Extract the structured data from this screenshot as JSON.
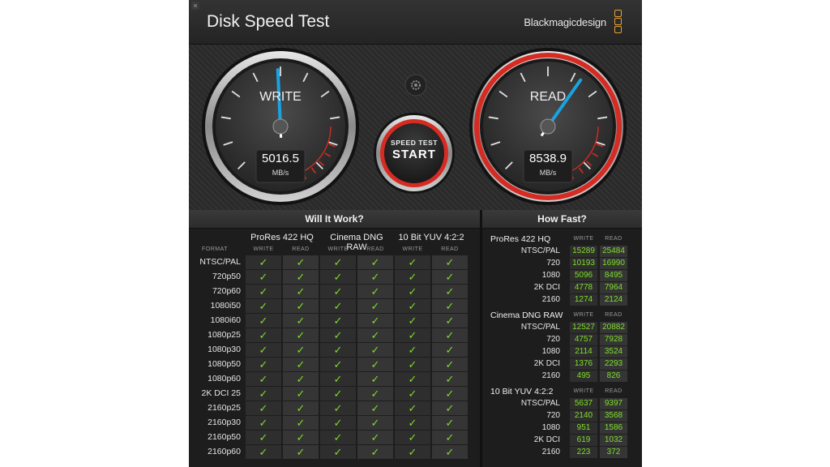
{
  "app": {
    "title": "Disk Speed Test",
    "brand": "Blackmagicdesign",
    "close_icon": "×"
  },
  "gauges": {
    "write": {
      "label": "WRITE",
      "value": "5016.5",
      "unit": "MB/s",
      "needle_fraction": 0.49
    },
    "read": {
      "label": "READ",
      "value": "8538.9",
      "unit": "MB/s",
      "needle_fraction": 0.63
    }
  },
  "start_button": {
    "top": "SPEED TEST",
    "main": "START"
  },
  "settings_icon": "gear-icon",
  "colors": {
    "accent": "#1aa3e0",
    "red": "#d52b22",
    "green": "#7fde2a",
    "orange": "#e8a035"
  },
  "will_it_work": {
    "title": "Will It Work?",
    "format_label": "FORMAT",
    "groups": [
      "ProRes 422 HQ",
      "Cinema DNG RAW",
      "10 Bit YUV 4:2:2"
    ],
    "sub_write": "WRITE",
    "sub_read": "READ",
    "check": "✓",
    "rows": [
      "NTSC/PAL",
      "720p50",
      "720p60",
      "1080i50",
      "1080i60",
      "1080p25",
      "1080p30",
      "1080p50",
      "1080p60",
      "2K DCI 25",
      "2160p25",
      "2160p30",
      "2160p50",
      "2160p60"
    ]
  },
  "how_fast": {
    "title": "How Fast?",
    "sub_write": "WRITE",
    "sub_read": "READ",
    "groups": [
      {
        "name": "ProRes 422 HQ",
        "rows": [
          {
            "label": "NTSC/PAL",
            "write": "15289",
            "read": "25484"
          },
          {
            "label": "720",
            "write": "10193",
            "read": "16990"
          },
          {
            "label": "1080",
            "write": "5096",
            "read": "8495"
          },
          {
            "label": "2K DCI",
            "write": "4778",
            "read": "7964"
          },
          {
            "label": "2160",
            "write": "1274",
            "read": "2124"
          }
        ]
      },
      {
        "name": "Cinema DNG RAW",
        "rows": [
          {
            "label": "NTSC/PAL",
            "write": "12527",
            "read": "20882"
          },
          {
            "label": "720",
            "write": "4757",
            "read": "7928"
          },
          {
            "label": "1080",
            "write": "2114",
            "read": "3524"
          },
          {
            "label": "2K DCI",
            "write": "1376",
            "read": "2293"
          },
          {
            "label": "2160",
            "write": "495",
            "read": "826"
          }
        ]
      },
      {
        "name": "10 Bit YUV 4:2:2",
        "rows": [
          {
            "label": "NTSC/PAL",
            "write": "5637",
            "read": "9397"
          },
          {
            "label": "720",
            "write": "2140",
            "read": "3568"
          },
          {
            "label": "1080",
            "write": "951",
            "read": "1586"
          },
          {
            "label": "2K DCI",
            "write": "619",
            "read": "1032"
          },
          {
            "label": "2160",
            "write": "223",
            "read": "372"
          }
        ]
      }
    ]
  }
}
